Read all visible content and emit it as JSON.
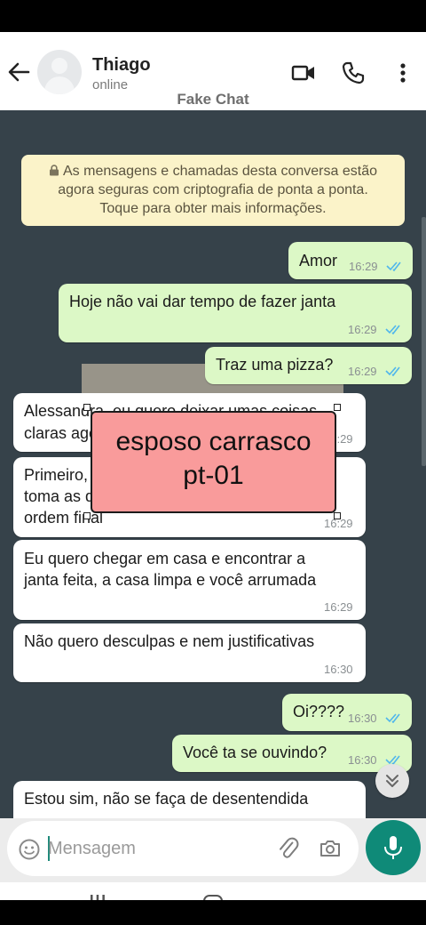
{
  "header": {
    "contact_name": "Thiago",
    "status": "online",
    "watermark": "Fake Chat",
    "icons": [
      "back-arrow-icon",
      "avatar",
      "video-call-icon",
      "voice-call-icon",
      "more-options-icon"
    ]
  },
  "notice": {
    "line1": "As mensagens e chamadas desta conversa estão",
    "line2": "agora seguras com criptografia de ponta a ponta.",
    "line3": "Toque para obter mais informações."
  },
  "messages": [
    {
      "dir": "out",
      "text": "Amor",
      "time": "16:29",
      "ticks": "read"
    },
    {
      "dir": "out",
      "text": "Hoje não vai dar tempo de fazer janta",
      "time": "16:29",
      "ticks": "read"
    },
    {
      "dir": "out",
      "text": "Traz uma pizza?",
      "time": "16:29",
      "ticks": "read"
    },
    {
      "dir": "in",
      "line1": "Alessandra, eu quero deixar umas coisas",
      "line2": "claras agora",
      "time": "16:29"
    },
    {
      "dir": "in",
      "line1": "Primeiro, aqui quem manda sou eu e quem",
      "line2": "toma as decisões sou eu e você segue",
      "line3": "ordem final",
      "time": "16:29"
    },
    {
      "dir": "in",
      "line1": "Eu quero chegar em casa e encontrar a",
      "line2": "janta feita, a casa limpa e você arrumada",
      "time": "16:29"
    },
    {
      "dir": "in",
      "text": "Não quero desculpas e nem justificativas",
      "time": "16:30"
    },
    {
      "dir": "out",
      "text": "Oi????",
      "time": "16:30",
      "ticks": "read"
    },
    {
      "dir": "out",
      "text": "Você ta se ouvindo?",
      "time": "16:30",
      "ticks": "read"
    },
    {
      "dir": "in",
      "text": "Estou sim, não se faça de desentendida"
    }
  ],
  "overlay": {
    "line1": "esposo carrasco",
    "line2": "pt-01"
  },
  "composer": {
    "placeholder": "Mensagem"
  },
  "colors": {
    "outgoing": "#dcf8c6",
    "incoming": "#ffffff",
    "chat_bg": "#36424a",
    "accent": "#0f8a78",
    "read_ticks": "#4fb6ec",
    "overlay": "#f99b9b"
  }
}
